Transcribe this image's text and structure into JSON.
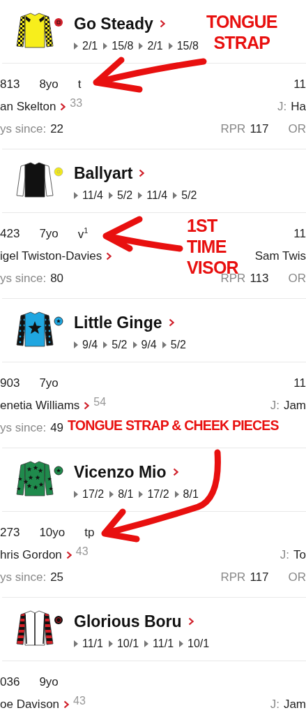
{
  "runners": [
    {
      "name": "Go Steady",
      "silk": {
        "kind": "check"
      },
      "odds": [
        "2/1",
        "15/8",
        "2/1",
        "15/8"
      ],
      "form": "813",
      "age": "8yo",
      "headgear": "t",
      "weight": "11",
      "trainer": "an Skelton",
      "trainer_number": "33",
      "jockey_label": "J:",
      "jockey": "Ha",
      "days_label": "ys since:",
      "days": "22",
      "rpr_label": "RPR",
      "rpr": "117",
      "or_label": "OR"
    },
    {
      "name": "Ballyart",
      "silk": {
        "kind": "plain"
      },
      "odds": [
        "11/4",
        "5/2",
        "11/4",
        "5/2"
      ],
      "form": "423",
      "age": "7yo",
      "headgear": "v$^{1}$",
      "weight": "11",
      "trainer": "igel Twiston-Davies",
      "jockey": "Sam Twis",
      "days_label": "ys since:",
      "days": "80",
      "rpr_label": "RPR",
      "rpr": "113",
      "or_label": "OR"
    },
    {
      "name": "Little Ginge",
      "silk": {
        "kind": "star"
      },
      "odds": [
        "9/4",
        "5/2",
        "9/4",
        "5/2"
      ],
      "form": "903",
      "age": "7yo",
      "weight": "11",
      "trainer": "enetia Williams",
      "trainer_number": "54",
      "jockey_label": "J:",
      "jockey": "Jam",
      "days_label": "ys since:",
      "days": "49"
    },
    {
      "name": "Vicenzo Mio",
      "silk": {
        "kind": "stars"
      },
      "odds": [
        "17/2",
        "8/1",
        "17/2",
        "8/1"
      ],
      "form": "273",
      "age": "10yo",
      "headgear": "tp",
      "trainer": "hris Gordon",
      "trainer_number": "43",
      "jockey_label": "J:",
      "jockey": "To",
      "days_label": "ys since:",
      "days": "25",
      "rpr_label": "RPR",
      "rpr": "117",
      "or_label": "OR"
    },
    {
      "name": "Glorious Boru",
      "silk": {
        "kind": "hoops"
      },
      "odds": [
        "11/1",
        "10/1",
        "11/1",
        "10/1"
      ],
      "form": "036",
      "age": "9yo",
      "trainer": "oe Davison",
      "trainer_number": "43",
      "jockey_label": "J:",
      "jockey": "Jam"
    }
  ],
  "annotations": [
    {
      "text": "TONGUE STRAP"
    },
    {
      "text": "1ST TIME VISOR"
    },
    {
      "text": "TONGUE STRAP & CHEEK PIECES"
    }
  ]
}
